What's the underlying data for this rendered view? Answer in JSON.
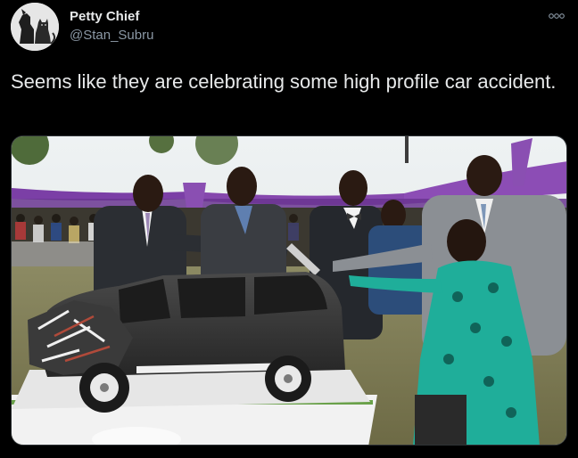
{
  "tweet": {
    "author": {
      "display_name": "Petty Chief",
      "handle": "@Stan_Subru",
      "avatar_icon": "dog-and-cat-avatar-icon"
    },
    "more_icon": "more-options-icon",
    "text": "Seems like they are celebrating some high profile car accident.",
    "media": {
      "kind": "photo"
    }
  },
  "colors": {
    "background": "#000000",
    "primary_text": "#e7e9ea",
    "secondary_text": "#8b98a5",
    "media_border": "#2f3336"
  }
}
